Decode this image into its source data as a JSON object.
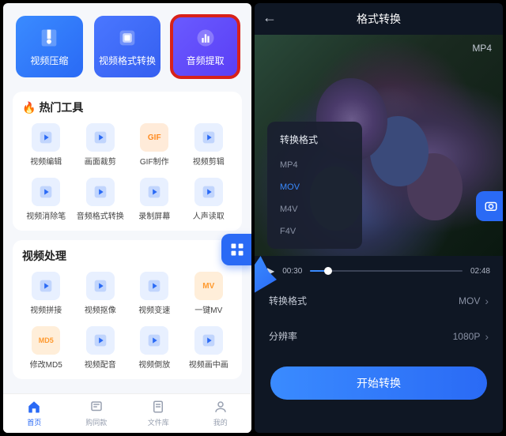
{
  "left": {
    "hero": [
      {
        "label": "视频压缩"
      },
      {
        "label": "视频格式转换"
      },
      {
        "label": "音频提取"
      }
    ],
    "section1": {
      "title": "热门工具",
      "tools": [
        {
          "label": "视频编辑"
        },
        {
          "label": "画面裁剪"
        },
        {
          "label": "GIF制作",
          "badge": "GIF"
        },
        {
          "label": "视频剪辑"
        },
        {
          "label": "视频消除笔"
        },
        {
          "label": "音频格式转换"
        },
        {
          "label": "录制屏幕"
        },
        {
          "label": "人声读取"
        }
      ]
    },
    "section2": {
      "title": "视频处理",
      "tools": [
        {
          "label": "视频拼接"
        },
        {
          "label": "视频抠像"
        },
        {
          "label": "视频变速"
        },
        {
          "label": "一键MV",
          "badge": "MV"
        },
        {
          "label": "修改MD5",
          "badge": "MD5"
        },
        {
          "label": "视频配音"
        },
        {
          "label": "视频倒放"
        },
        {
          "label": "视频画中画"
        }
      ]
    },
    "tabs": [
      {
        "label": "首页"
      },
      {
        "label": "购同款"
      },
      {
        "label": "文件库"
      },
      {
        "label": "我的"
      }
    ]
  },
  "right": {
    "title": "格式转换",
    "badge": "MP4",
    "fmt_title": "转换格式",
    "formats": [
      "MP4",
      "MOV",
      "M4V",
      "F4V"
    ],
    "selected_format_index": 1,
    "player": {
      "current": "00:30",
      "total": "02:48"
    },
    "rows": [
      {
        "label": "转换格式",
        "value": "MOV"
      },
      {
        "label": "分辨率",
        "value": "1080P"
      }
    ],
    "cta": "开始转换"
  }
}
